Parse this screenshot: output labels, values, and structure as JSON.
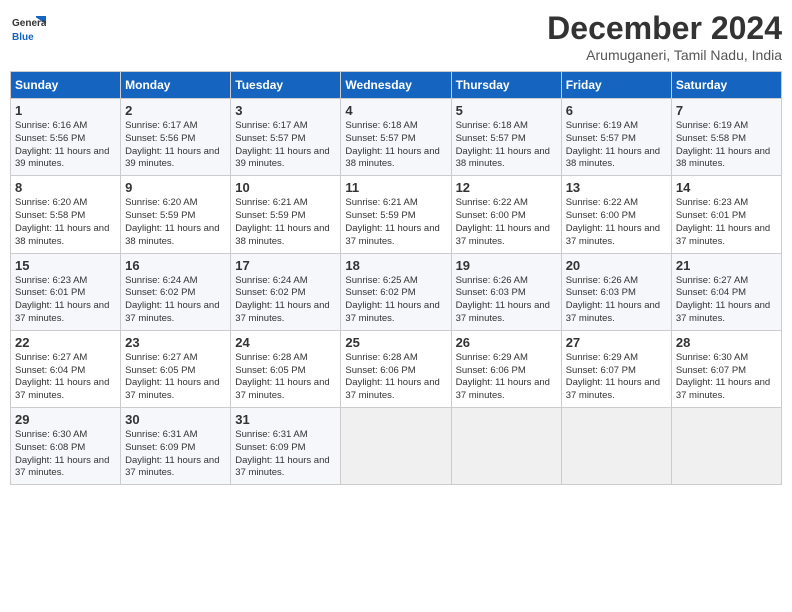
{
  "logo": {
    "line1": "General",
    "line2": "Blue"
  },
  "title": "December 2024",
  "subtitle": "Arumuganeri, Tamil Nadu, India",
  "weekdays": [
    "Sunday",
    "Monday",
    "Tuesday",
    "Wednesday",
    "Thursday",
    "Friday",
    "Saturday"
  ],
  "weeks": [
    [
      {
        "day": "1",
        "sunrise": "Sunrise: 6:16 AM",
        "sunset": "Sunset: 5:56 PM",
        "daylight": "Daylight: 11 hours and 39 minutes."
      },
      {
        "day": "2",
        "sunrise": "Sunrise: 6:17 AM",
        "sunset": "Sunset: 5:56 PM",
        "daylight": "Daylight: 11 hours and 39 minutes."
      },
      {
        "day": "3",
        "sunrise": "Sunrise: 6:17 AM",
        "sunset": "Sunset: 5:57 PM",
        "daylight": "Daylight: 11 hours and 39 minutes."
      },
      {
        "day": "4",
        "sunrise": "Sunrise: 6:18 AM",
        "sunset": "Sunset: 5:57 PM",
        "daylight": "Daylight: 11 hours and 38 minutes."
      },
      {
        "day": "5",
        "sunrise": "Sunrise: 6:18 AM",
        "sunset": "Sunset: 5:57 PM",
        "daylight": "Daylight: 11 hours and 38 minutes."
      },
      {
        "day": "6",
        "sunrise": "Sunrise: 6:19 AM",
        "sunset": "Sunset: 5:57 PM",
        "daylight": "Daylight: 11 hours and 38 minutes."
      },
      {
        "day": "7",
        "sunrise": "Sunrise: 6:19 AM",
        "sunset": "Sunset: 5:58 PM",
        "daylight": "Daylight: 11 hours and 38 minutes."
      }
    ],
    [
      {
        "day": "8",
        "sunrise": "Sunrise: 6:20 AM",
        "sunset": "Sunset: 5:58 PM",
        "daylight": "Daylight: 11 hours and 38 minutes."
      },
      {
        "day": "9",
        "sunrise": "Sunrise: 6:20 AM",
        "sunset": "Sunset: 5:59 PM",
        "daylight": "Daylight: 11 hours and 38 minutes."
      },
      {
        "day": "10",
        "sunrise": "Sunrise: 6:21 AM",
        "sunset": "Sunset: 5:59 PM",
        "daylight": "Daylight: 11 hours and 38 minutes."
      },
      {
        "day": "11",
        "sunrise": "Sunrise: 6:21 AM",
        "sunset": "Sunset: 5:59 PM",
        "daylight": "Daylight: 11 hours and 37 minutes."
      },
      {
        "day": "12",
        "sunrise": "Sunrise: 6:22 AM",
        "sunset": "Sunset: 6:00 PM",
        "daylight": "Daylight: 11 hours and 37 minutes."
      },
      {
        "day": "13",
        "sunrise": "Sunrise: 6:22 AM",
        "sunset": "Sunset: 6:00 PM",
        "daylight": "Daylight: 11 hours and 37 minutes."
      },
      {
        "day": "14",
        "sunrise": "Sunrise: 6:23 AM",
        "sunset": "Sunset: 6:01 PM",
        "daylight": "Daylight: 11 hours and 37 minutes."
      }
    ],
    [
      {
        "day": "15",
        "sunrise": "Sunrise: 6:23 AM",
        "sunset": "Sunset: 6:01 PM",
        "daylight": "Daylight: 11 hours and 37 minutes."
      },
      {
        "day": "16",
        "sunrise": "Sunrise: 6:24 AM",
        "sunset": "Sunset: 6:02 PM",
        "daylight": "Daylight: 11 hours and 37 minutes."
      },
      {
        "day": "17",
        "sunrise": "Sunrise: 6:24 AM",
        "sunset": "Sunset: 6:02 PM",
        "daylight": "Daylight: 11 hours and 37 minutes."
      },
      {
        "day": "18",
        "sunrise": "Sunrise: 6:25 AM",
        "sunset": "Sunset: 6:02 PM",
        "daylight": "Daylight: 11 hours and 37 minutes."
      },
      {
        "day": "19",
        "sunrise": "Sunrise: 6:26 AM",
        "sunset": "Sunset: 6:03 PM",
        "daylight": "Daylight: 11 hours and 37 minutes."
      },
      {
        "day": "20",
        "sunrise": "Sunrise: 6:26 AM",
        "sunset": "Sunset: 6:03 PM",
        "daylight": "Daylight: 11 hours and 37 minutes."
      },
      {
        "day": "21",
        "sunrise": "Sunrise: 6:27 AM",
        "sunset": "Sunset: 6:04 PM",
        "daylight": "Daylight: 11 hours and 37 minutes."
      }
    ],
    [
      {
        "day": "22",
        "sunrise": "Sunrise: 6:27 AM",
        "sunset": "Sunset: 6:04 PM",
        "daylight": "Daylight: 11 hours and 37 minutes."
      },
      {
        "day": "23",
        "sunrise": "Sunrise: 6:27 AM",
        "sunset": "Sunset: 6:05 PM",
        "daylight": "Daylight: 11 hours and 37 minutes."
      },
      {
        "day": "24",
        "sunrise": "Sunrise: 6:28 AM",
        "sunset": "Sunset: 6:05 PM",
        "daylight": "Daylight: 11 hours and 37 minutes."
      },
      {
        "day": "25",
        "sunrise": "Sunrise: 6:28 AM",
        "sunset": "Sunset: 6:06 PM",
        "daylight": "Daylight: 11 hours and 37 minutes."
      },
      {
        "day": "26",
        "sunrise": "Sunrise: 6:29 AM",
        "sunset": "Sunset: 6:06 PM",
        "daylight": "Daylight: 11 hours and 37 minutes."
      },
      {
        "day": "27",
        "sunrise": "Sunrise: 6:29 AM",
        "sunset": "Sunset: 6:07 PM",
        "daylight": "Daylight: 11 hours and 37 minutes."
      },
      {
        "day": "28",
        "sunrise": "Sunrise: 6:30 AM",
        "sunset": "Sunset: 6:07 PM",
        "daylight": "Daylight: 11 hours and 37 minutes."
      }
    ],
    [
      {
        "day": "29",
        "sunrise": "Sunrise: 6:30 AM",
        "sunset": "Sunset: 6:08 PM",
        "daylight": "Daylight: 11 hours and 37 minutes."
      },
      {
        "day": "30",
        "sunrise": "Sunrise: 6:31 AM",
        "sunset": "Sunset: 6:09 PM",
        "daylight": "Daylight: 11 hours and 37 minutes."
      },
      {
        "day": "31",
        "sunrise": "Sunrise: 6:31 AM",
        "sunset": "Sunset: 6:09 PM",
        "daylight": "Daylight: 11 hours and 37 minutes."
      },
      null,
      null,
      null,
      null
    ]
  ]
}
